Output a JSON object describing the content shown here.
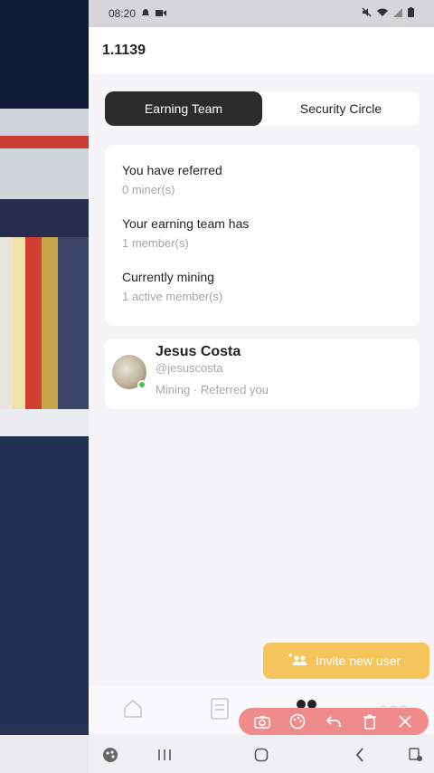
{
  "status_bar": {
    "time": "08:20"
  },
  "header": {
    "balance": "1.1139"
  },
  "tabs": [
    {
      "label": "Earning Team",
      "active": true
    },
    {
      "label": "Security Circle",
      "active": false
    }
  ],
  "stats": [
    {
      "label": "You have referred",
      "value": "0 miner(s)"
    },
    {
      "label": "Your earning team has",
      "value": "1 member(s)"
    },
    {
      "label": "Currently mining",
      "value": "1 active member(s)"
    }
  ],
  "member": {
    "name": "Jesus Costa",
    "handle": "@jesuscosta",
    "status": "Mining · Referred you"
  },
  "invite_button": {
    "label": "Invite new user"
  },
  "colors": {
    "tab_active_bg": "#2b2b2b",
    "invite_bg": "#f5c04d",
    "toolbar_bg": "#f08b8b",
    "online": "#49c35a"
  },
  "icons": {
    "bottom_nav": [
      "home-icon",
      "document-icon",
      "team-icon",
      "more-icon"
    ],
    "toolbar": [
      "camera-icon",
      "palette-icon",
      "undo-icon",
      "trash-icon",
      "close-icon"
    ],
    "system_nav": [
      "recent-apps-icon",
      "home-button-icon",
      "back-icon"
    ]
  }
}
